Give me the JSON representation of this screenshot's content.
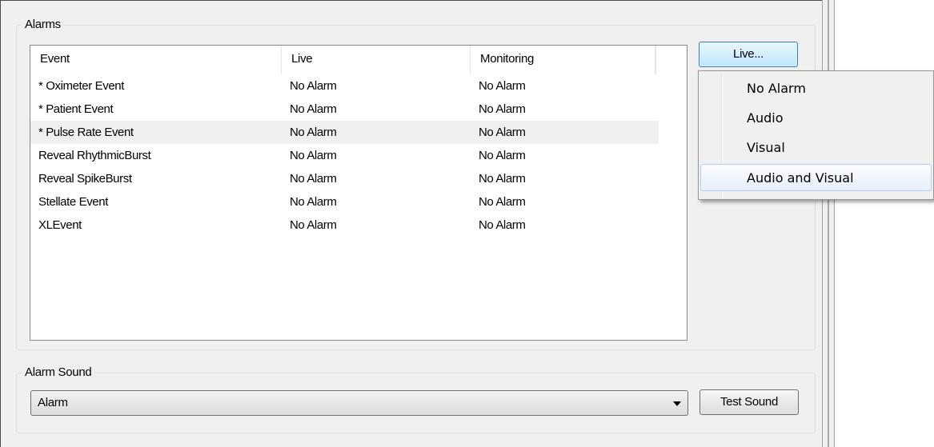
{
  "alarms_group": {
    "title": "Alarms",
    "columns": [
      "Event",
      "Live",
      "Monitoring"
    ],
    "rows": [
      {
        "event": "* Oximeter Event",
        "live": "No Alarm",
        "monitoring": "No Alarm"
      },
      {
        "event": "* Patient Event",
        "live": "No Alarm",
        "monitoring": "No Alarm"
      },
      {
        "event": "* Pulse Rate Event",
        "live": "No Alarm",
        "monitoring": "No Alarm"
      },
      {
        "event": "Reveal RhythmicBurst",
        "live": "No Alarm",
        "monitoring": "No Alarm"
      },
      {
        "event": "Reveal SpikeBurst",
        "live": "No Alarm",
        "monitoring": "No Alarm"
      },
      {
        "event": "Stellate Event",
        "live": "No Alarm",
        "monitoring": "No Alarm"
      },
      {
        "event": "XLEvent",
        "live": "No Alarm",
        "monitoring": "No Alarm"
      }
    ],
    "live_button_label": "Live..."
  },
  "live_menu": {
    "items": [
      "No Alarm",
      "Audio",
      "Visual",
      "Audio and Visual"
    ],
    "highlighted": "Audio and Visual"
  },
  "alarm_sound_group": {
    "title": "Alarm Sound",
    "selected_sound": "Alarm",
    "test_button_label": "Test Sound"
  },
  "colors": {
    "window_background": "#f0f0f0",
    "row_hover": "#f0f0f0",
    "button_focus_border": "#3c7fb1",
    "menu_highlight_border": "#aecff7"
  }
}
